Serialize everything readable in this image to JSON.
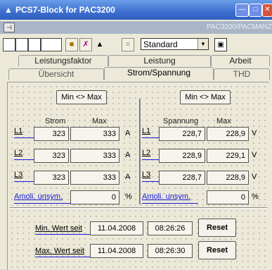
{
  "window": {
    "title": "PCS7-Block for PAC3200",
    "plant_path": "PAC3200/PACMANZ"
  },
  "toolbar": {
    "view_select": "Standard"
  },
  "tabs": {
    "row_back": [
      "Leistungsfaktor",
      "Leistung",
      "Arbeit"
    ],
    "row_front": [
      "Übersicht",
      "Strom/Spannung",
      "THD"
    ],
    "active": "Strom/Spannung"
  },
  "current": {
    "minmax_button": "Min <> Max",
    "col_value": "Strom",
    "col_max": "Max",
    "unit": "A",
    "rows": [
      {
        "label": "L1",
        "value": "323",
        "max": "333"
      },
      {
        "label": "L2",
        "value": "323",
        "max": "333"
      },
      {
        "label": "L3",
        "value": "323",
        "max": "333"
      }
    ],
    "asym_label": "Amoli. unsym.",
    "asym_value": "0",
    "asym_unit": "%"
  },
  "voltage": {
    "minmax_button": "Min <> Max",
    "col_value": "Spannung",
    "col_max": "Max",
    "unit": "V",
    "rows": [
      {
        "label": "L1",
        "value": "228,7",
        "max": "228,9"
      },
      {
        "label": "L2",
        "value": "228,9",
        "max": "229,1"
      },
      {
        "label": "L3",
        "value": "228,7",
        "max": "228,9"
      }
    ],
    "asym_label": "Amoli. unsym.",
    "asym_value": "0",
    "asym_unit": "%"
  },
  "reset": {
    "min_label": "Min. Wert seit",
    "min_date": "11.04.2008",
    "min_time": "08:26:26",
    "max_label": "Max. Wert seit",
    "max_date": "11.04.2008",
    "max_time": "08:26:30",
    "reset_label": "Reset"
  },
  "colors": {
    "titlebar": "#3d6fd0",
    "label_line": "#1a1adc",
    "panel_bg": "#ece9d8"
  }
}
